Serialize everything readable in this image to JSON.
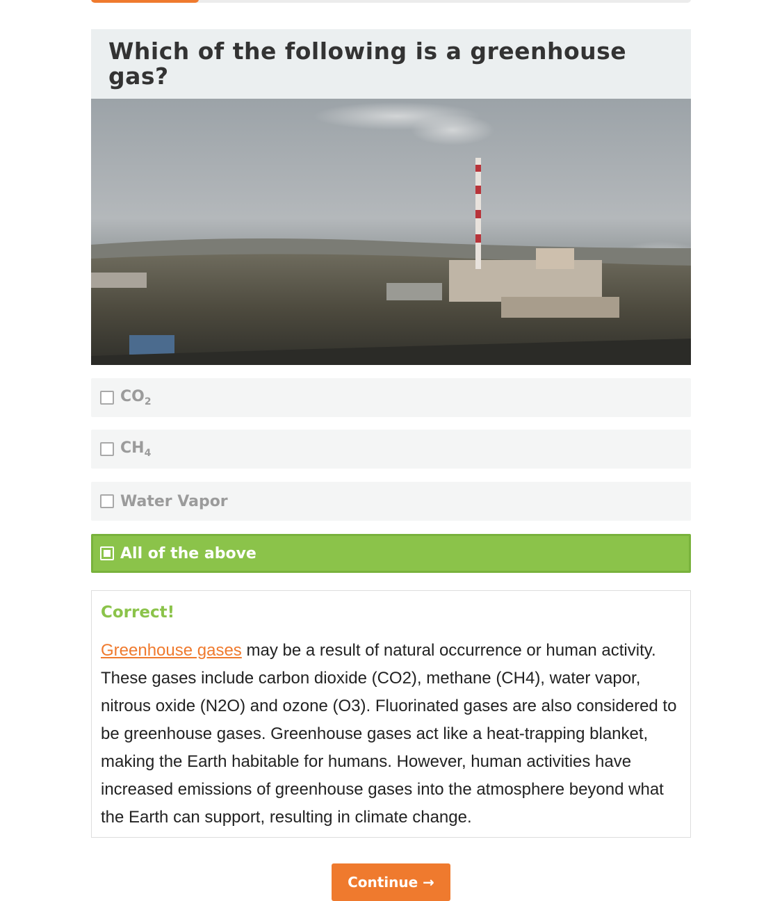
{
  "quiz": {
    "progress_fraction": 0.18,
    "question": "Which of the following is a greenhouse gas?"
  },
  "options": [
    {
      "label": "CO",
      "subscript": "2",
      "selected": false
    },
    {
      "label": "CH",
      "subscript": "4",
      "selected": false
    },
    {
      "label": "Water Vapor",
      "selected": false
    },
    {
      "label": "All of the above",
      "selected": true
    }
  ],
  "feedback": {
    "title": "Correct!",
    "link_text": "Greenhouse gases",
    "body": " may be a result of natural occurrence or human activity. These gases include carbon dioxide (CO2), methane (CH4), water vapor, nitrous oxide (N2O) and ozone (O3). Fluorinated gases are also considered to be greenhouse gases. Greenhouse gases act like a heat-trapping blanket, making the Earth habitable for humans. However, human activities have increased emissions of greenhouse gases into the atmosphere beyond what the Earth can support, resulting in climate change."
  },
  "continue_label": "Continue →",
  "colors": {
    "accent": "#ef7a2e",
    "correct": "#8bc34a"
  }
}
